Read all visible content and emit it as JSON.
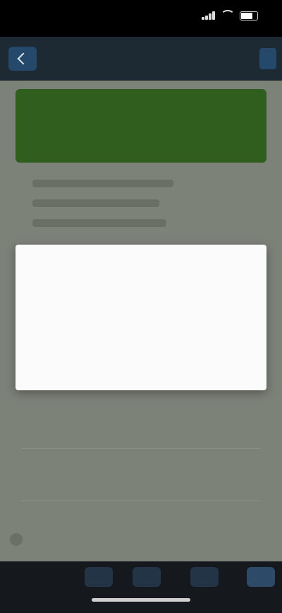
{
  "status_bar": {
    "time": "",
    "signal_bars": 4,
    "battery_level_percent": 80
  },
  "app_bar": {
    "title": "",
    "action_label": "",
    "back_icon": "chevron-left-icon",
    "menu_icon": "menu-icon"
  },
  "banner": {
    "text": "",
    "color": "#2f5e1f"
  },
  "info": {
    "lines": [
      "",
      "",
      ""
    ]
  },
  "below": {
    "label": "",
    "danger_link": "",
    "items": [
      "",
      ""
    ]
  },
  "dialog": {
    "title": "",
    "body": "",
    "link": "",
    "button": "",
    "button_color": "#4a9a3c",
    "link_color": "#3b73c4"
  },
  "bottom_nav": {
    "items": [
      "home-icon",
      "search-icon",
      "activity-icon",
      "profile-icon"
    ],
    "active_index": 3
  },
  "colors": {
    "app_bar": "#1d2a33",
    "scrim_background": "#7d8279",
    "accent": "#2d4a68"
  }
}
